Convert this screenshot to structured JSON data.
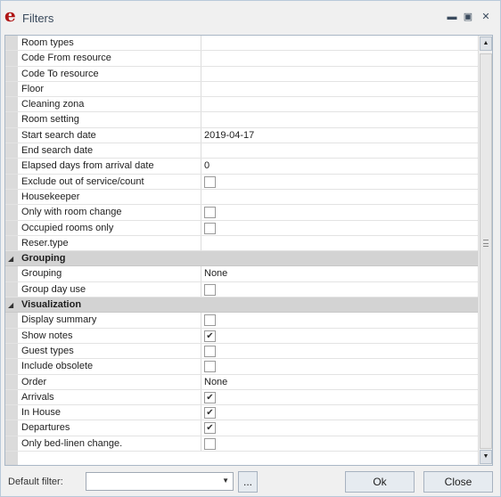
{
  "window": {
    "logo": "e",
    "title": "Filters",
    "minimize_glyph": "▬",
    "restore_glyph": "▣",
    "close_glyph": "✕"
  },
  "filters": [
    {
      "type": "item",
      "label": "Room types",
      "value": ""
    },
    {
      "type": "item",
      "label": "Code From resource",
      "value": ""
    },
    {
      "type": "item",
      "label": "Code To resource",
      "value": ""
    },
    {
      "type": "item",
      "label": "Floor",
      "value": ""
    },
    {
      "type": "item",
      "label": "Cleaning zona",
      "value": ""
    },
    {
      "type": "item",
      "label": "Room setting",
      "value": ""
    },
    {
      "type": "item",
      "label": "Start search date",
      "value": "2019-04-17"
    },
    {
      "type": "item",
      "label": "End search date",
      "value": ""
    },
    {
      "type": "item",
      "label": "Elapsed days from arrival date",
      "value": "0"
    },
    {
      "type": "check",
      "label": "Exclude out of service/count",
      "checked": false
    },
    {
      "type": "item",
      "label": "Housekeeper",
      "value": ""
    },
    {
      "type": "check",
      "label": "Only with room change",
      "checked": false
    },
    {
      "type": "check",
      "label": "Occupied rooms only",
      "checked": false
    },
    {
      "type": "item",
      "label": "Reser.type",
      "value": ""
    },
    {
      "type": "group",
      "label": "Grouping"
    },
    {
      "type": "item",
      "label": "Grouping",
      "value": "None"
    },
    {
      "type": "check",
      "label": "Group day use",
      "checked": false
    },
    {
      "type": "group",
      "label": "Visualization"
    },
    {
      "type": "check",
      "label": "Display summary",
      "checked": false
    },
    {
      "type": "check",
      "label": "Show notes",
      "checked": true
    },
    {
      "type": "check",
      "label": "Guest types",
      "checked": false
    },
    {
      "type": "check",
      "label": "Include obsolete",
      "checked": false
    },
    {
      "type": "item",
      "label": "Order",
      "value": "None"
    },
    {
      "type": "check",
      "label": "Arrivals",
      "checked": true
    },
    {
      "type": "check",
      "label": "In House",
      "checked": true
    },
    {
      "type": "check",
      "label": "Departures",
      "checked": true
    },
    {
      "type": "check",
      "label": "Only bed-linen change.",
      "checked": false
    }
  ],
  "footer": {
    "default_filter_label": "Default filter:",
    "default_filter_value": "",
    "browse_label": "...",
    "ok_label": "Ok",
    "close_label": "Close"
  },
  "icons": {
    "check": "✔",
    "collapse": "◢",
    "scroll_up": "▲",
    "scroll_down": "▼",
    "combo_arrow": "▼"
  }
}
